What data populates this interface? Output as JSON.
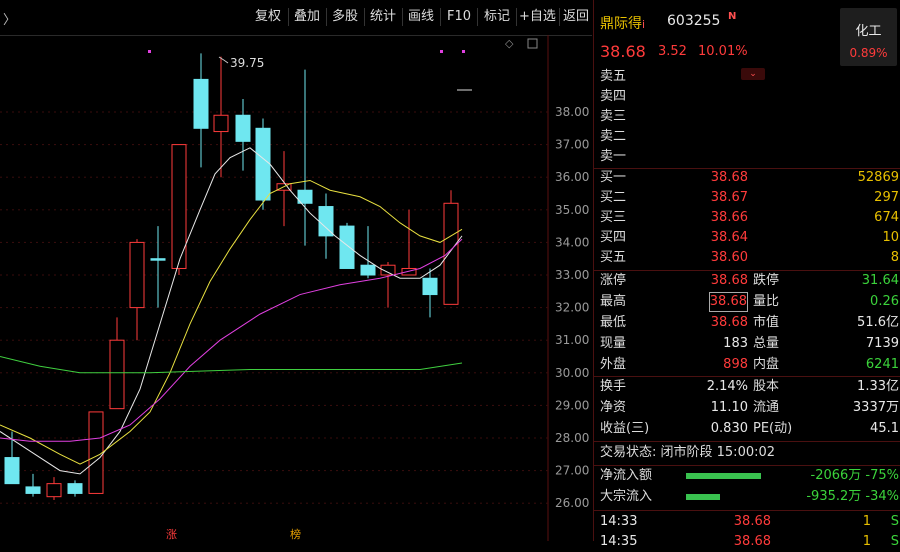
{
  "toolbar": {
    "back_arrow": "〉",
    "buttons": [
      "复权",
      "叠加",
      "多股",
      "统计",
      "画线",
      "F10",
      "标记",
      "+自选",
      "返回"
    ]
  },
  "chart": {
    "y_ticks": [
      "38.00",
      "37.00",
      "36.00",
      "35.00",
      "34.00",
      "33.00",
      "32.00",
      "31.00",
      "30.00",
      "29.00",
      "28.00",
      "27.00",
      "26.00"
    ],
    "high_label": "39.75",
    "day_marks": [
      "涨",
      "榜"
    ],
    "diamond_icon": "◇"
  },
  "stock": {
    "name": "鼎际得",
    "name_tag": "i",
    "code": "603255",
    "n_badge": "N",
    "price": "38.68",
    "change": "3.52",
    "change_pct": "10.01%",
    "sector_name": "化工",
    "sector_pct": "0.89%"
  },
  "order_book": {
    "asks": [
      {
        "label": "卖五",
        "price": "",
        "vol": ""
      },
      {
        "label": "卖四",
        "price": "",
        "vol": ""
      },
      {
        "label": "卖三",
        "price": "",
        "vol": ""
      },
      {
        "label": "卖二",
        "price": "",
        "vol": ""
      },
      {
        "label": "卖一",
        "price": "",
        "vol": ""
      }
    ],
    "bids": [
      {
        "label": "买一",
        "price": "38.68",
        "vol": "52869"
      },
      {
        "label": "买二",
        "price": "38.67",
        "vol": "297"
      },
      {
        "label": "买三",
        "price": "38.66",
        "vol": "674"
      },
      {
        "label": "买四",
        "price": "38.64",
        "vol": "10"
      },
      {
        "label": "买五",
        "price": "38.60",
        "vol": "8"
      }
    ]
  },
  "stats": [
    {
      "l1": "涨停",
      "v1": "38.68",
      "c1": "red",
      "l2": "跌停",
      "v2": "31.64",
      "c2": "green"
    },
    {
      "l1": "最高",
      "v1": "38.68",
      "c1": "red",
      "l2": "量比",
      "v2": "0.26",
      "c2": "green",
      "hl": true
    },
    {
      "l1": "最低",
      "v1": "38.68",
      "c1": "red",
      "l2": "市值",
      "v2": "51.6亿",
      "c2": "white"
    },
    {
      "l1": "现量",
      "v1": "183",
      "c1": "white",
      "l2": "总量",
      "v2": "7139",
      "c2": "white"
    },
    {
      "l1": "外盘",
      "v1": "898",
      "c1": "red",
      "l2": "内盘",
      "v2": "6241",
      "c2": "green"
    }
  ],
  "fundamentals": [
    {
      "l1": "换手",
      "v1": "2.14%",
      "l2": "股本",
      "v2": "1.33亿"
    },
    {
      "l1": "净资",
      "v1": "11.10",
      "l2": "流通",
      "v2": "3337万"
    },
    {
      "l1": "收益(三)",
      "v1": "0.830",
      "l2": "PE(动)",
      "v2": "45.1"
    }
  ],
  "trade_status": "交易状态: 闭市阶段 15:00:02",
  "flows": [
    {
      "label": "净流入额",
      "value": "-2066万",
      "pct": "-75%",
      "fill": 0.75
    },
    {
      "label": "大宗流入",
      "value": "-935.2万",
      "pct": "-34%",
      "fill": 0.34
    }
  ],
  "ticks": [
    {
      "time": "14:33",
      "price": "38.68",
      "vol": "1",
      "side": "S"
    },
    {
      "time": "14:35",
      "price": "38.68",
      "vol": "1",
      "side": "S"
    }
  ],
  "colors": {
    "up": "#ff3b3b",
    "down": "#6fe7f0",
    "ma5": "#e8e8e8",
    "ma10": "#e8e040",
    "ma20": "#e040e0",
    "ma60": "#40d040"
  }
}
